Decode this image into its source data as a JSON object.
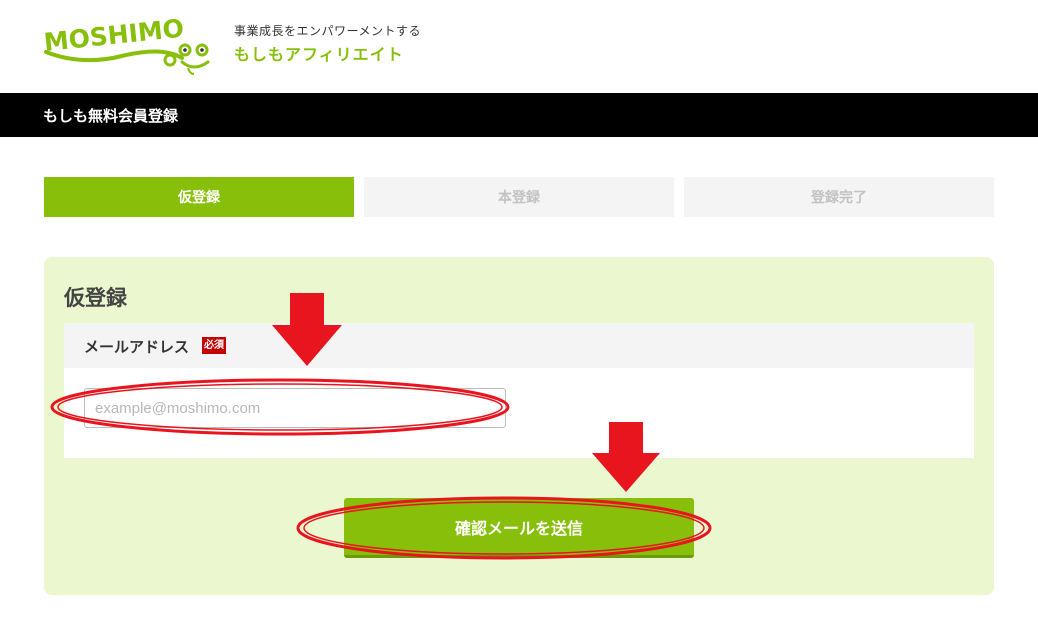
{
  "header": {
    "logo_text": "MOSHIMO",
    "tagline_sub": "事業成長をエンパワーメントする",
    "tagline_main": "もしもアフィリエイト"
  },
  "titlebar": {
    "title": "もしも無料会員登録"
  },
  "steps": [
    {
      "label": "仮登録",
      "state": "active"
    },
    {
      "label": "本登録",
      "state": "inactive"
    },
    {
      "label": "登録完了",
      "state": "inactive"
    }
  ],
  "form": {
    "title": "仮登録",
    "email_label": "メールアドレス",
    "required_badge": "必須",
    "email_placeholder": "example@moshimo.com",
    "email_value": "",
    "submit_label": "確認メールを送信"
  },
  "annotations": {
    "color": "#e8141e",
    "items": [
      "arrow-to-email-field",
      "circle-email-field",
      "arrow-to-submit-button",
      "circle-submit-button"
    ]
  },
  "colors": {
    "brand_green": "#88bf0b",
    "panel_bg": "#eaf7cf",
    "titlebar_bg": "#000000",
    "required_red": "#c40000"
  }
}
